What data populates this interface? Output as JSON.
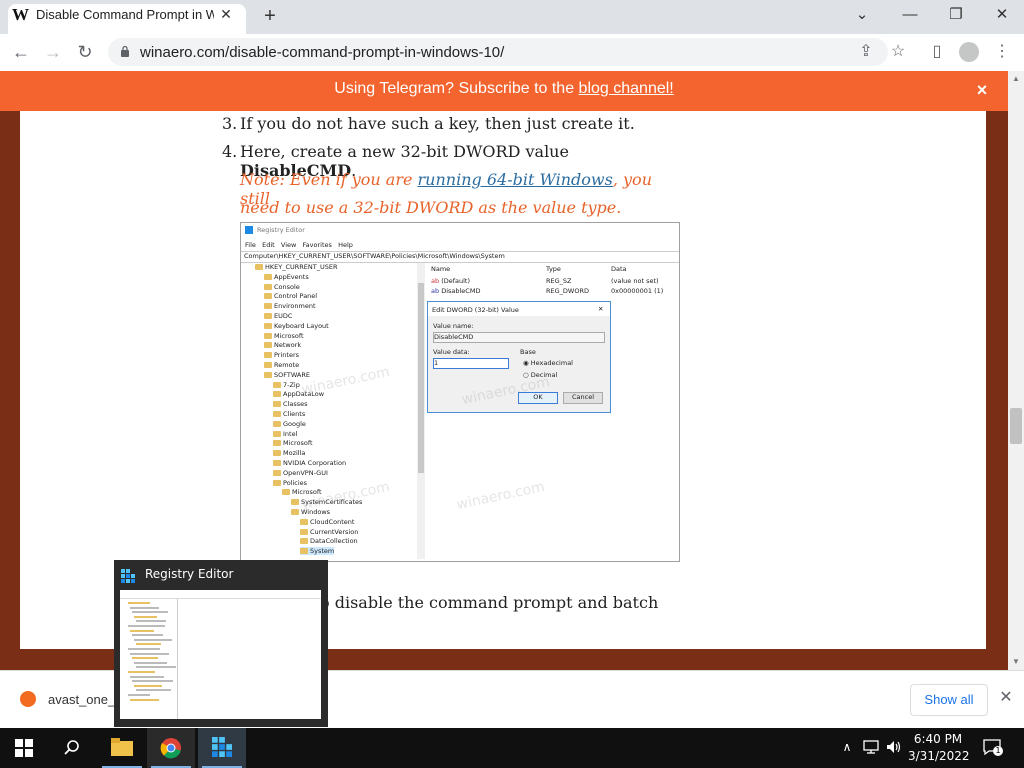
{
  "browser": {
    "tab_title": "Disable Command Prompt in Wi",
    "favicon_letter": "W",
    "url": "winaero.com/disable-command-prompt-in-windows-10/"
  },
  "banner": {
    "text_prefix": "Using Telegram? Subscribe to the ",
    "link_text": "blog channel!",
    "close": "×"
  },
  "article": {
    "step3_num": "3.",
    "step3": "If you do not have such a key, then just create it.",
    "step4_num": "4.",
    "step4_prefix": "Here, create a new 32-bit DWORD value ",
    "step4_bold": "DisableCMD",
    "step4_suffix": ".",
    "note_prefix": "Note: Even if you are ",
    "note_link": "running 64-bit Windows",
    "note_suffix1": ", you still",
    "note_line2": "need to use a 32-bit DWORD as the value type.",
    "next_line_visible": "o disable the command prompt and batch"
  },
  "regedit": {
    "title": "Registry Editor",
    "menu": [
      "File",
      "Edit",
      "View",
      "Favorites",
      "Help"
    ],
    "address": "Computer\\HKEY_CURRENT_USER\\SOFTWARE\\Policies\\Microsoft\\Windows\\System",
    "tree": [
      {
        "label": "HKEY_CURRENT_USER",
        "indent": 0
      },
      {
        "label": "AppEvents",
        "indent": 1
      },
      {
        "label": "Console",
        "indent": 1
      },
      {
        "label": "Control Panel",
        "indent": 1
      },
      {
        "label": "Environment",
        "indent": 1
      },
      {
        "label": "EUDC",
        "indent": 1
      },
      {
        "label": "Keyboard Layout",
        "indent": 1
      },
      {
        "label": "Microsoft",
        "indent": 1
      },
      {
        "label": "Network",
        "indent": 1
      },
      {
        "label": "Printers",
        "indent": 1
      },
      {
        "label": "Remote",
        "indent": 1
      },
      {
        "label": "SOFTWARE",
        "indent": 1
      },
      {
        "label": "7-Zip",
        "indent": 2
      },
      {
        "label": "AppDataLow",
        "indent": 2
      },
      {
        "label": "Classes",
        "indent": 2
      },
      {
        "label": "Clients",
        "indent": 2
      },
      {
        "label": "Google",
        "indent": 2
      },
      {
        "label": "Intel",
        "indent": 2
      },
      {
        "label": "Microsoft",
        "indent": 2
      },
      {
        "label": "Mozilla",
        "indent": 2
      },
      {
        "label": "NVIDIA Corporation",
        "indent": 2
      },
      {
        "label": "OpenVPN-GUI",
        "indent": 2
      },
      {
        "label": "Policies",
        "indent": 2
      },
      {
        "label": "Microsoft",
        "indent": 3
      },
      {
        "label": "SystemCertificates",
        "indent": 4
      },
      {
        "label": "Windows",
        "indent": 4
      },
      {
        "label": "CloudContent",
        "indent": 5
      },
      {
        "label": "CurrentVersion",
        "indent": 5
      },
      {
        "label": "DataCollection",
        "indent": 5
      },
      {
        "label": "System",
        "indent": 5
      }
    ],
    "columns": [
      "Name",
      "Type",
      "Data"
    ],
    "values": [
      {
        "name": "(Default)",
        "type": "REG_SZ",
        "data": "(value not set)"
      },
      {
        "name": "DisableCMD",
        "type": "REG_DWORD",
        "data": "0x00000001 (1)"
      }
    ],
    "dialog": {
      "title": "Edit DWORD (32-bit) Value",
      "close": "✕",
      "value_name_label": "Value name:",
      "value_name": "DisableCMD",
      "value_data_label": "Value data:",
      "value_data": "1",
      "base_label": "Base",
      "hex_label": "Hexadecimal",
      "dec_label": "Decimal",
      "ok": "OK",
      "cancel": "Cancel"
    },
    "watermark": "winaero.com"
  },
  "downloads": {
    "file": "avast_one_e",
    "show_all": "Show all"
  },
  "taskbar_preview": {
    "title": "Registry Editor"
  },
  "clock": {
    "time": "6:40 PM",
    "date": "3/31/2022"
  },
  "colors": {
    "banner": "#f4642e",
    "note": "#e8632a",
    "link": "#2b6ca0"
  }
}
